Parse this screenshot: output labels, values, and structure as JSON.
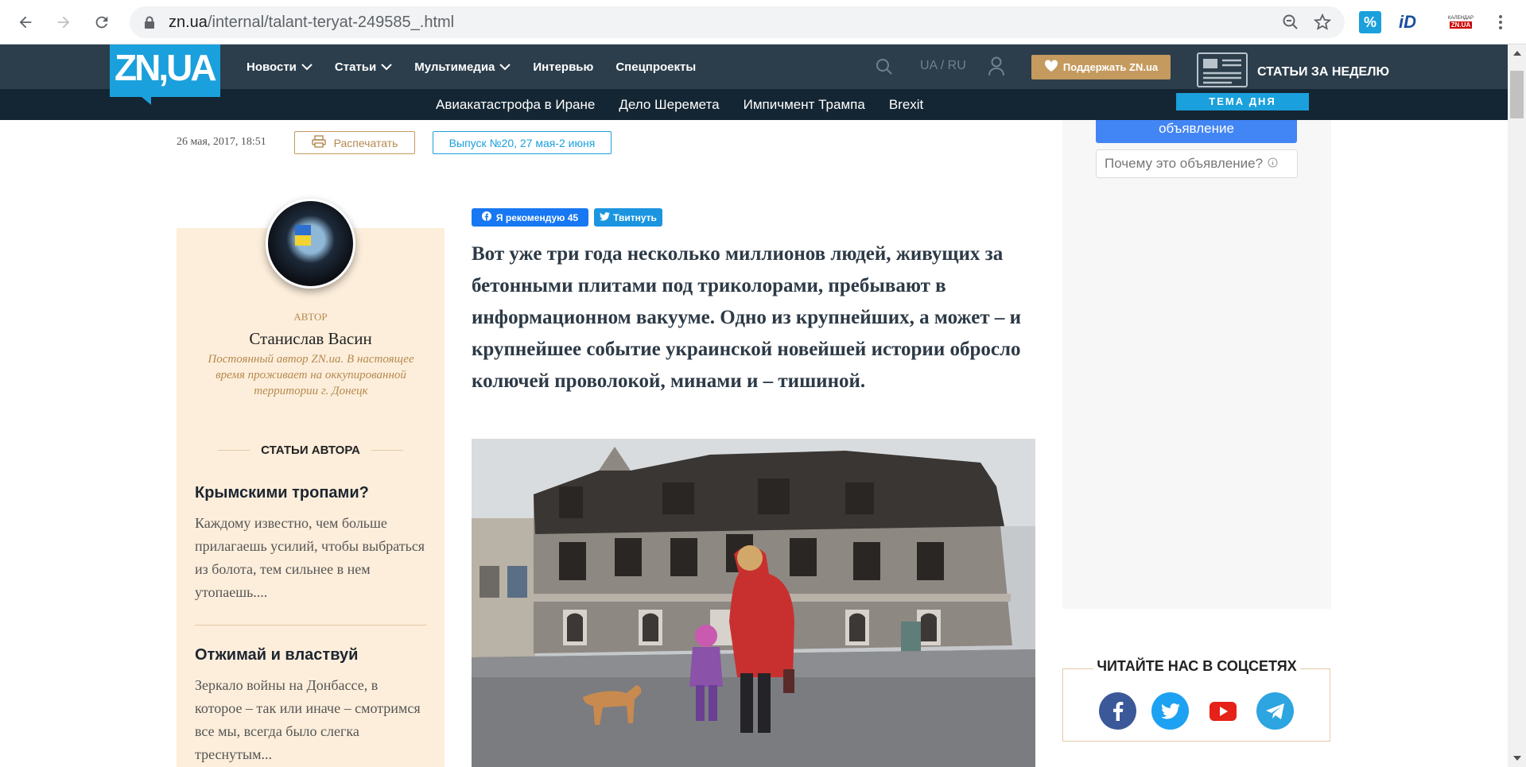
{
  "browser": {
    "url_host": "zn.ua",
    "url_path": "/internal/talant-teryat-249585_.html",
    "extensions": [
      "percent-icon",
      "id-icon",
      "zn-calendar-icon"
    ]
  },
  "header": {
    "logo": "ZN,UA",
    "nav": [
      "Новости",
      "Статьи",
      "Мультимедиа",
      "Интервью",
      "Спецпроекты"
    ],
    "lang": "UA / RU",
    "support": "Поддержать ZN.ua",
    "weekly": "СТАТЬИ ЗА НЕДЕЛЮ",
    "tema": "ТЕМА ДНЯ",
    "subnav": [
      "Авиакатастрофа в Иране",
      "Дело Шеремета",
      "Импичмент Трампа",
      "Brexit"
    ]
  },
  "meta": {
    "date": "26 мая, 2017, 18:51",
    "print": "Распечатать",
    "issue": "Выпуск №20, 27 мая-2 июня"
  },
  "author": {
    "label": "АВТОР",
    "name": "Станислав Васин",
    "desc": "Постоянный автор ZN.ua. В настоящее время проживает на оккупированной территории г. Донецк",
    "articles_heading": "СТАТЬИ АВТОРА",
    "articles": [
      {
        "title": "Крымскими тропами?",
        "desc": "Каждому известно, чем больше прилагаешь усилий, чтобы выбраться из болота, тем сильнее в нем утопаешь...."
      },
      {
        "title": "Отжимай и властвуй",
        "desc": "Зеркало войны на Донбассе, в которое – так или иначе – смотримся все мы, всегда было слегка треснутым..."
      }
    ]
  },
  "share": {
    "fb": "Я рекомендую 45",
    "tw": "Твитнуть"
  },
  "lead": "Вот уже три года несколько миллионов людей, живущих за бетонными плитами под триколорами, пребывают в информационном вакууме. Одно из крупнейших, а может – и крупнейшее событие украинской новейшей истории обросло колючей проволокой, минами и – тишиной.",
  "ad": {
    "button": "объявление",
    "why": "Почему это объявление?"
  },
  "social": {
    "title": "ЧИТАЙТЕ НАС В СОЦСЕТЯХ",
    "icons": [
      "facebook-icon",
      "twitter-icon",
      "youtube-icon",
      "telegram-icon"
    ],
    "colors": {
      "facebook": "#3b5998",
      "twitter": "#1da1f2",
      "youtube": "#ffffff",
      "telegram": "#2ca5e0"
    }
  },
  "colors": {
    "header_bg": "#2c3e4c",
    "subnav_bg": "#142633",
    "brand_blue": "#1aa0dc",
    "accent_gold": "#c49a5e",
    "author_bg": "#fdeedb"
  }
}
